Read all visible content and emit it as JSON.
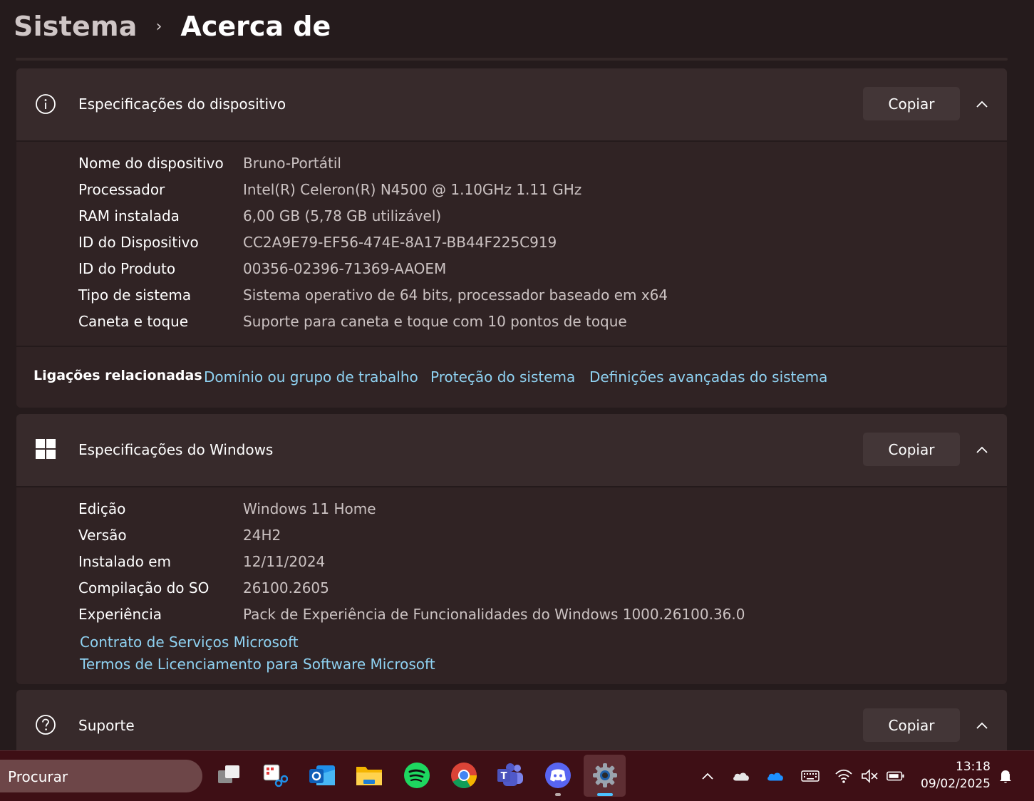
{
  "breadcrumb": {
    "parent": "Sistema",
    "separator": "›",
    "current": "Acerca de"
  },
  "device_specs": {
    "title": "Especificações do dispositivo",
    "icon": "info-icon",
    "copy_label": "Copiar",
    "rows": [
      {
        "label": "Nome do dispositivo",
        "value": "Bruno-Portátil"
      },
      {
        "label": "Processador",
        "value": "Intel(R) Celeron(R) N4500 @ 1.10GHz   1.11 GHz"
      },
      {
        "label": "RAM instalada",
        "value": "6,00 GB (5,78 GB utilizável)"
      },
      {
        "label": "ID do Dispositivo",
        "value": "CC2A9E79-EF56-474E-8A17-BB44F225C919"
      },
      {
        "label": "ID do Produto",
        "value": "00356-02396-71369-AAOEM"
      },
      {
        "label": "Tipo de sistema",
        "value": "Sistema operativo de 64 bits, processador baseado em x64"
      },
      {
        "label": "Caneta e toque",
        "value": "Suporte para caneta e toque com 10 pontos de toque"
      }
    ]
  },
  "related_links": {
    "label": "Ligações relacionadas",
    "links": [
      "Domínio ou grupo de trabalho",
      "Proteção do sistema",
      "Definições avançadas do sistema"
    ]
  },
  "windows_specs": {
    "title": "Especificações do Windows",
    "icon": "windows-logo-icon",
    "copy_label": "Copiar",
    "rows": [
      {
        "label": "Edição",
        "value": "Windows 11 Home"
      },
      {
        "label": "Versão",
        "value": "24H2"
      },
      {
        "label": "Instalado em",
        "value": "12/11/2024"
      },
      {
        "label": "Compilação do SO",
        "value": "26100.2605"
      },
      {
        "label": "Experiência",
        "value": "Pack de Experiência de Funcionalidades do Windows 1000.26100.36.0"
      }
    ],
    "links": [
      "Contrato de Serviços Microsoft",
      "Termos de Licenciamento para Software Microsoft"
    ]
  },
  "support": {
    "title": "Suporte",
    "icon": "help-icon",
    "copy_label": "Copiar"
  },
  "taskbar": {
    "search_placeholder": "Procurar",
    "apps": [
      "task-view-icon",
      "snipping-tool-icon",
      "outlook-icon",
      "file-explorer-icon",
      "spotify-icon",
      "chrome-icon",
      "teams-icon",
      "discord-icon",
      "settings-icon"
    ],
    "tray": [
      "show-hidden-icons-chevron",
      "onedrive-personal-icon",
      "onedrive-business-icon",
      "keyboard-icon",
      "wifi-icon",
      "volume-muted-icon",
      "battery-icon"
    ],
    "time": "13:18",
    "date": "09/02/2025",
    "accent_color": "#4cc2ff"
  },
  "colors": {
    "link": "#8fd2f2",
    "card": "#302324",
    "card_header": "#372a2b",
    "background": "#251b1c"
  }
}
